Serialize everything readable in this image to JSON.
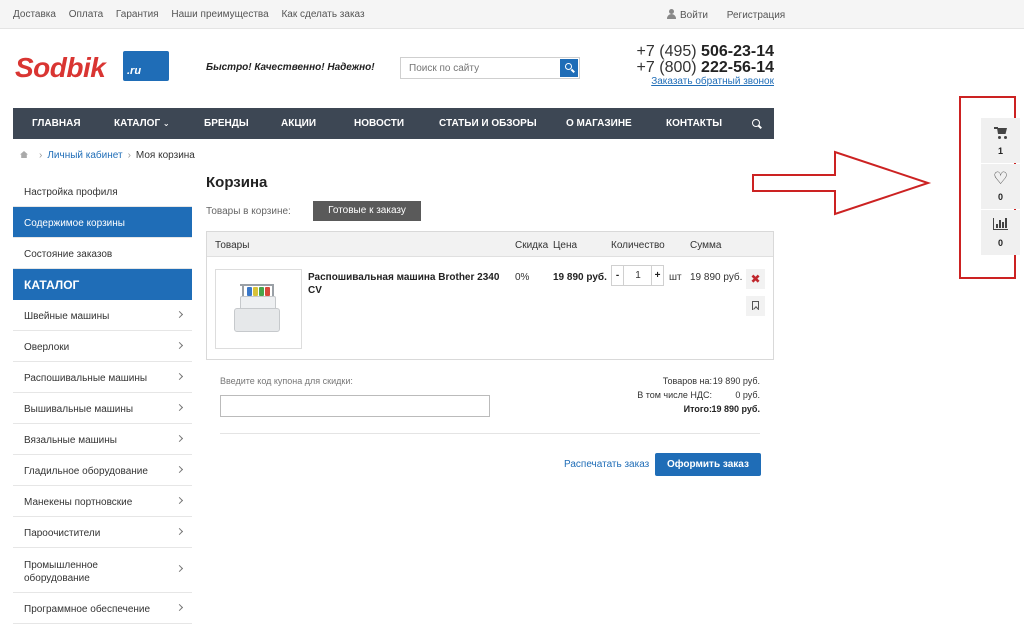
{
  "topbar": {
    "links": [
      "Доставка",
      "Оплата",
      "Гарантия",
      "Наши преимущества",
      "Как сделать заказ"
    ],
    "login": "Войти",
    "register": "Регистрация"
  },
  "header": {
    "logo_text": "Sodbik",
    "logo_suffix": ".ru",
    "slogan": "Быстро! Качественно! Надежно!",
    "search_placeholder": "Поиск по сайту",
    "phone1_prefix": "+7 (495)",
    "phone1_number": "506-23-14",
    "phone2_prefix": "+7 (800)",
    "phone2_number": "222-56-14",
    "callback": "Заказать обратный звонок"
  },
  "nav": {
    "items": [
      "ГЛАВНАЯ",
      "КАТАЛОГ",
      "БРЕНДЫ",
      "АКЦИИ",
      "НОВОСТИ",
      "СТАТЬИ И ОБЗОРЫ",
      "О МАГАЗИНЕ",
      "КОНТАКТЫ"
    ]
  },
  "breadcrumb": {
    "cabinet": "Личный кабинет",
    "current": "Моя корзина"
  },
  "sidebar": {
    "account": [
      "Настройка профиля",
      "Содержимое корзины",
      "Состояние заказов"
    ],
    "catalog_title": "КАТАЛОГ",
    "catalog": [
      "Швейные машины",
      "Оверлоки",
      "Распошивальные машины",
      "Вышивальные машины",
      "Вязальные машины",
      "Гладильное оборудование",
      "Манекены портновские",
      "Пароочистители",
      "Промышленное оборудование",
      "Программное обеспечение"
    ]
  },
  "cart": {
    "title": "Корзина",
    "in_cart_label": "Товары в корзине:",
    "ready_button": "Готовые к заказу",
    "columns": {
      "product": "Товары",
      "discount": "Скидка",
      "price": "Цена",
      "quantity": "Количество",
      "sum": "Сумма"
    },
    "item": {
      "name": "Распошивальная машина Brother 2340 CV",
      "discount": "0%",
      "price": "19 890 руб.",
      "qty": "1",
      "minus": "-",
      "plus": "+",
      "unit": "шт",
      "sum": "19 890 руб.",
      "delete_glyph": "✖"
    },
    "coupon_label": "Введите код купона для скидки:",
    "totals": {
      "goods_label": "Товаров на:",
      "goods_value": "19 890 руб.",
      "vat_label": "В том числе НДС:",
      "vat_value": "0 руб.",
      "total_label": "Итого:",
      "total_value": "19 890 руб."
    },
    "print_link": "Распечатать заказ",
    "order_button": "Оформить заказ"
  },
  "widgets": {
    "cart_count": "1",
    "favorites_count": "0",
    "compare_count": "0"
  },
  "colors": {
    "brand_blue": "#1f6db7",
    "logo_red": "#d93532",
    "nav_bg": "#3d4754",
    "annotation_red": "#cc2222"
  }
}
